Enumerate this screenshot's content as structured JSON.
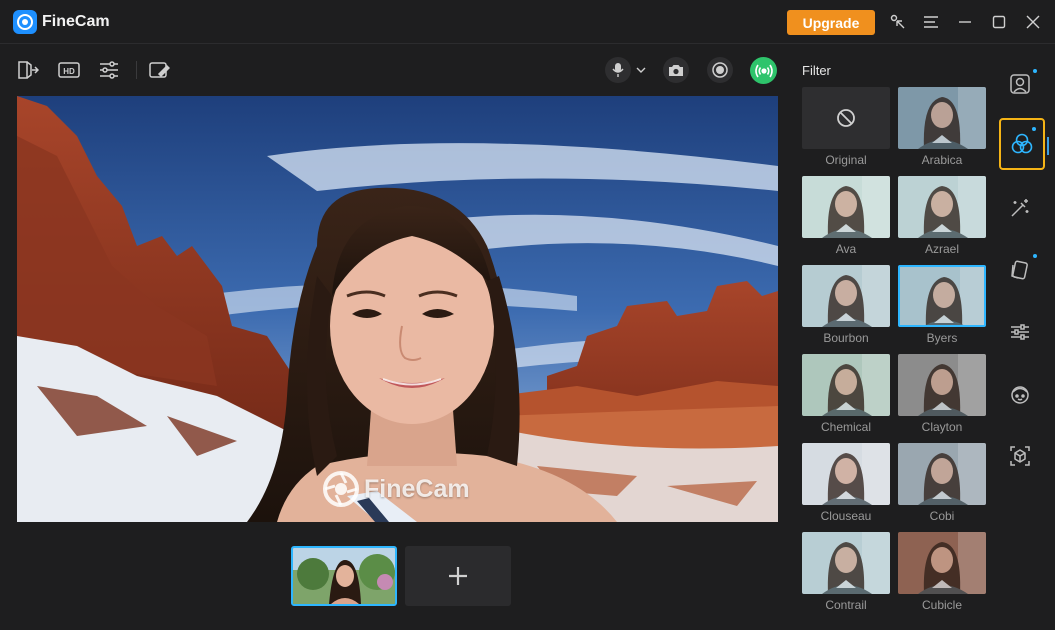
{
  "app": {
    "title": "FineCam",
    "upgrade_label": "Upgrade"
  },
  "titlebar_icons": [
    "pointer-icon",
    "menu-icon",
    "minimize-icon",
    "maximize-icon",
    "close-icon"
  ],
  "toolbar": {
    "left_icons": [
      "exit-icon",
      "hd-icon",
      "adjust-icon",
      "annotate-icon"
    ],
    "hd_label": "HD",
    "right_icons": [
      "microphone-icon",
      "chevron-down-icon",
      "camera-icon",
      "record-icon",
      "live-icon"
    ]
  },
  "preview": {
    "watermark": "FineCam"
  },
  "filter_panel": {
    "title": "Filter",
    "selected": "Byers",
    "items": [
      {
        "label": "Original",
        "tone": "none"
      },
      {
        "label": "Arabica",
        "tone": "#7e98a8"
      },
      {
        "label": "Ava",
        "tone": "#c7dcd9"
      },
      {
        "label": "Azrael",
        "tone": "#bcd2d4"
      },
      {
        "label": "Bourbon",
        "tone": "#b6ccd2"
      },
      {
        "label": "Byers",
        "tone": "#a9c2cc"
      },
      {
        "label": "Chemical",
        "tone": "#aec7bd"
      },
      {
        "label": "Clayton",
        "tone": "#8d8d8d"
      },
      {
        "label": "Clouseau",
        "tone": "#d6dde2"
      },
      {
        "label": "Cobi",
        "tone": "#9aa7b1"
      },
      {
        "label": "Contrail",
        "tone": "#b9ced4"
      },
      {
        "label": "Cubicle",
        "tone": "#8e6252"
      }
    ]
  },
  "sidebar_icons": [
    "portrait-icon",
    "filter-icon",
    "magic-wand-icon",
    "sticker-icon",
    "sliders-icon",
    "avatar-icon",
    "ar-icon"
  ],
  "colors": {
    "accent": "#2eb6ff",
    "upgrade": "#f0901e",
    "active_border": "#f5b416",
    "live": "#2ec46b"
  }
}
